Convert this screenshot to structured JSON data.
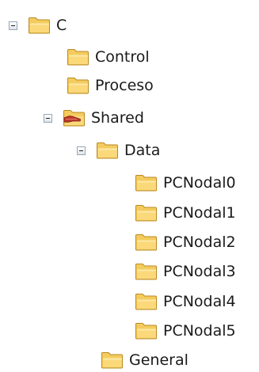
{
  "tree": {
    "root": {
      "label": "C",
      "expanded": true
    },
    "control": {
      "label": "Control"
    },
    "proceso": {
      "label": "Proceso"
    },
    "shared": {
      "label": "Shared",
      "expanded": true
    },
    "data": {
      "label": "Data",
      "expanded": true
    },
    "pcnodal0": {
      "label": "PCNodal0"
    },
    "pcnodal1": {
      "label": "PCNodal1"
    },
    "pcnodal2": {
      "label": "PCNodal2"
    },
    "pcnodal3": {
      "label": "PCNodal3"
    },
    "pcnodal4": {
      "label": "PCNodal4"
    },
    "pcnodal5": {
      "label": "PCNodal5"
    },
    "general": {
      "label": "General"
    }
  },
  "colors": {
    "folder_body": "#f4cb5e",
    "folder_light": "#fde9a6",
    "folder_outline": "#b98a22",
    "shared_hand": "#c0392b"
  },
  "icons": {
    "folder": "folder-icon",
    "shared_folder": "shared-folder-icon",
    "collapse": "collapse-icon"
  }
}
